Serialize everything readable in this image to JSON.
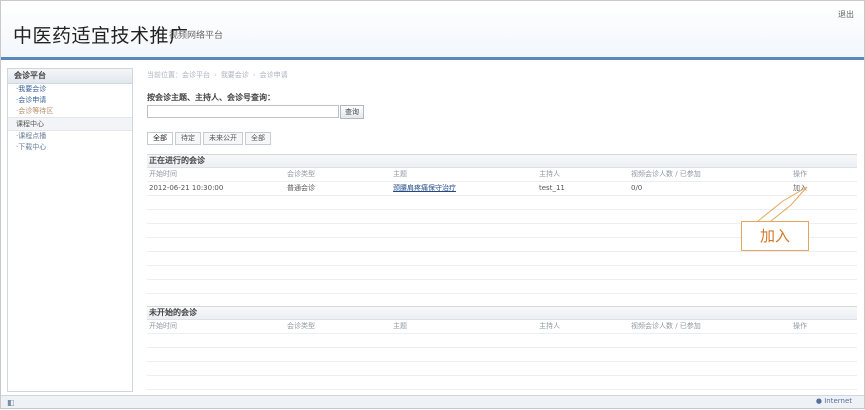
{
  "header": {
    "brand": "中医药适宜技术推广",
    "subtitle": "视频网络平台",
    "action": "退出"
  },
  "sidebar": {
    "group1_label": "会诊平台",
    "items": [
      {
        "label": "·我要会诊"
      },
      {
        "label": "·会诊申请"
      },
      {
        "label": "·会诊等待区"
      }
    ],
    "group2_label": "课程中心",
    "items2": [
      {
        "label": "·课程点播"
      },
      {
        "label": "·下载中心"
      }
    ]
  },
  "breadcrumb": [
    "当前位置：会诊平台",
    "我要会诊",
    "会诊申请"
  ],
  "search": {
    "label": "按会诊主题、主持人、会诊号查询：",
    "value": "",
    "button": "查询"
  },
  "tabs": [
    "全部",
    "待定",
    "未来公开",
    "全部"
  ],
  "table1": {
    "title": "正在进行的会诊",
    "columns": [
      "开始时间",
      "会诊类型",
      "主题",
      "主持人",
      "视频会诊人数 / 已参加",
      "操作"
    ],
    "rows": [
      {
        "cells": [
          "2012-06-21 10:30:00",
          "普通会诊",
          "颈腰肩疼痛保守治疗",
          "test_11",
          "0/0",
          "加入"
        ]
      }
    ]
  },
  "table2": {
    "title": "未开始的会诊",
    "columns": [
      "开始时间",
      "会诊类型",
      "主题",
      "主持人",
      "视频会诊人数 / 已参加",
      "操作"
    ],
    "rows": []
  },
  "callout": {
    "label": "加入"
  },
  "statusbar": {
    "zone": "Internet"
  },
  "colors": {
    "accent": "#5b87bd",
    "callout": "#d07a2a",
    "link": "#224a87"
  }
}
